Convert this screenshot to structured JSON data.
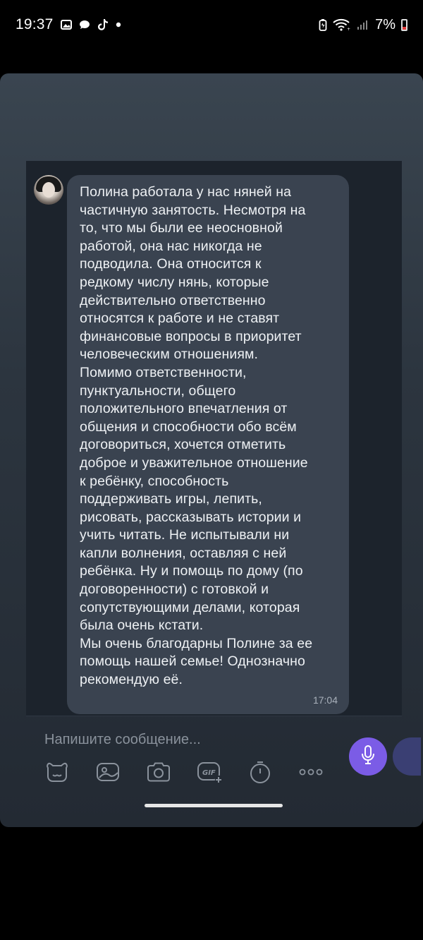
{
  "status_bar": {
    "time": "19:37",
    "battery": "7%",
    "icons": [
      "gallery-icon",
      "chat-icon",
      "tiktok-icon",
      "dot-icon",
      "battery-saver-icon",
      "wifi-icon",
      "signal-icon",
      "battery-icon"
    ]
  },
  "chat": {
    "message": {
      "text": "Полина работала у нас няней на\nчастичную занятость. Несмотря на\nто, что мы были ее неосновной\nработой, она нас никогда не\nподводила. Она относится к\nредкому числу нянь, которые\nдействительно ответственно\nотносятся к работе и не ставят\nфинансовые вопросы в приоритет\nчеловеческим отношениям.\nПомимо ответственности,\nпунктуальности, общего\nположительного впечатления от\nобщения и способности обо всём\nдоговориться, хочется отметить\nдоброе и уважительное отношение\nк ребёнку, способность\nподдерживать игры, лепить,\nрисовать, рассказывать истории и\nучить читать. Не испытывали ни\nкапли волнения, оставляя с ней\nребёнка. Ну и помощь по дому (по\nдоговоренности) с готовкой и\nсопутствующими делами, которая\nбыла очень кстати.\nМы очень благодарны Полине за ее\nпомощь нашей семье! Однозначно\nрекомендую её.",
      "time": "17:04"
    }
  },
  "composer": {
    "placeholder": "Напишите сообщение...",
    "tools": [
      "sticker-icon",
      "gallery-icon",
      "camera-icon",
      "gif-icon",
      "timer-icon",
      "more-icon"
    ],
    "gif_label": "GIF"
  },
  "colors": {
    "bubble": "#3a4350",
    "mic_button": "#7b5ce6"
  }
}
